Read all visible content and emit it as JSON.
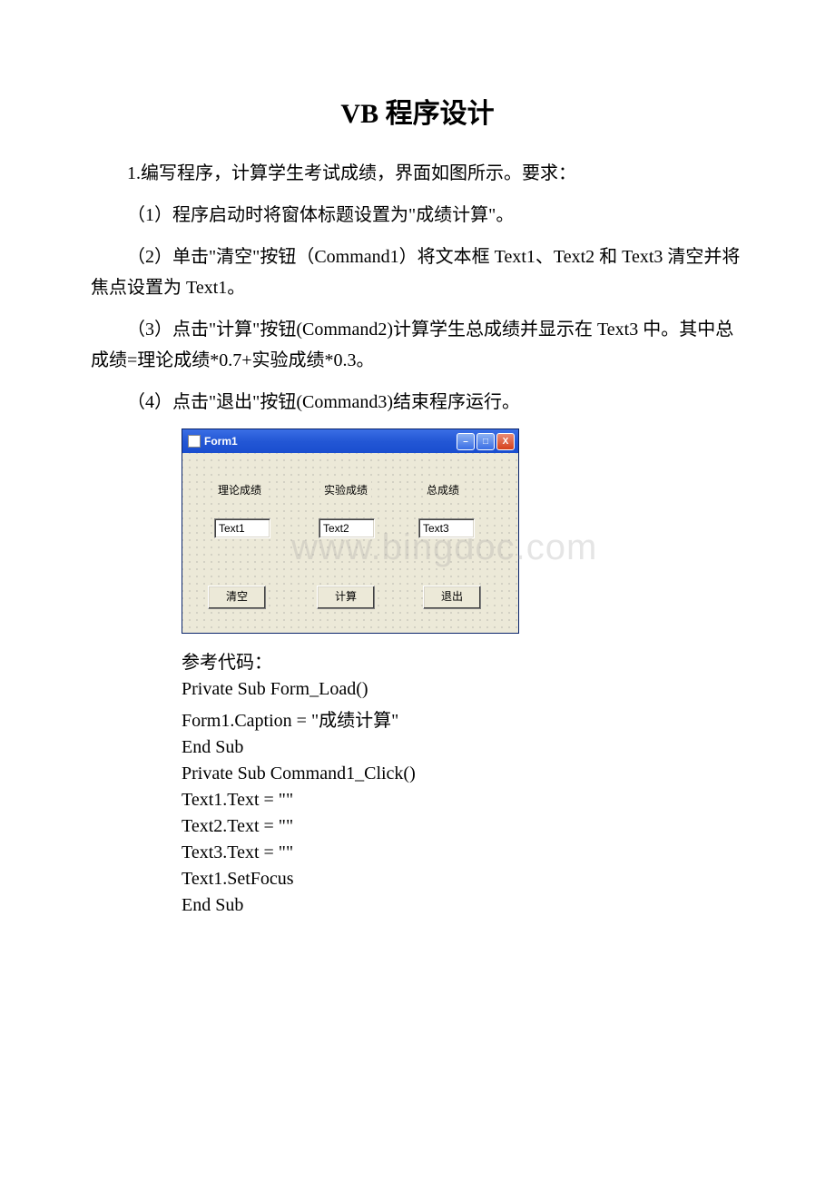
{
  "title": "VB 程序设计",
  "paragraphs": {
    "p1": "1.编写程序，计算学生考试成绩，界面如图所示。要求：",
    "p2": "（1）程序启动时将窗体标题设置为\"成绩计算\"。",
    "p3": "（2）单击\"清空\"按钮（Command1）将文本框 Text1、Text2 和 Text3 清空并将焦点设置为 Text1。",
    "p4": "（3）点击\"计算\"按钮(Command2)计算学生总成绩并显示在 Text3 中。其中总成绩=理论成绩*0.7+实验成绩*0.3。",
    "p5": "（4）点击\"退出\"按钮(Command3)结束程序运行。"
  },
  "form": {
    "title": "Form1",
    "labels": {
      "l1": "理论成绩",
      "l2": "实验成绩",
      "l3": "总成绩"
    },
    "texts": {
      "t1": "Text1",
      "t2": "Text2",
      "t3": "Text3"
    },
    "buttons": {
      "b1": "清空",
      "b2": "计算",
      "b3": "退出"
    },
    "win": {
      "min": "–",
      "max": "□",
      "close": "X"
    }
  },
  "watermark": "www.bingdoc.com",
  "code": {
    "label": "参考代码：",
    "lines": [
      "Private Sub Form_Load()",
      "Form1.Caption = \"成绩计算\"",
      "End Sub",
      "Private Sub Command1_Click()",
      "Text1.Text = \"\"",
      "Text2.Text = \"\"",
      "Text3.Text = \"\"",
      "Text1.SetFocus",
      "End Sub"
    ]
  }
}
